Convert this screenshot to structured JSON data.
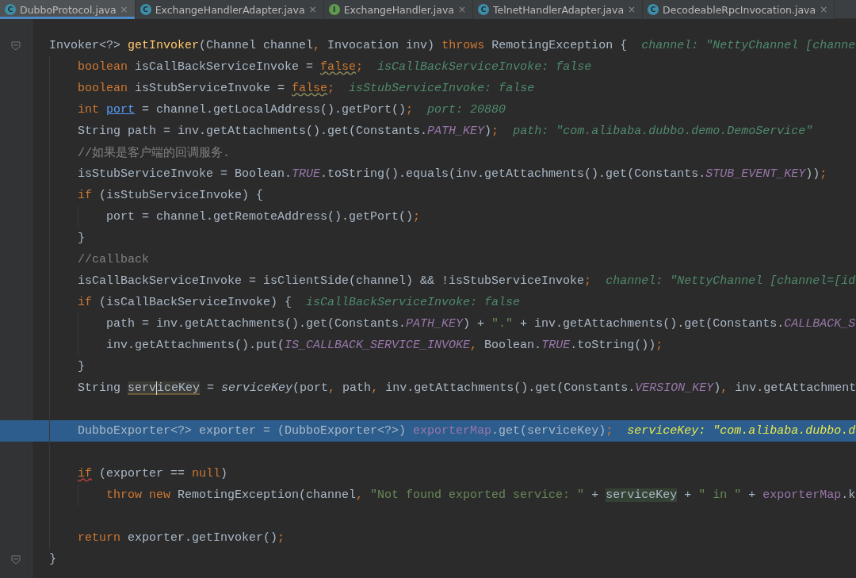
{
  "tabs": [
    {
      "label": "DubboProtocol.java",
      "icon": "C",
      "kind": "class",
      "close": "×",
      "selected": true
    },
    {
      "label": "ExchangeHandlerAdapter.java",
      "icon": "C",
      "kind": "abstract",
      "close": "×",
      "selected": false
    },
    {
      "label": "ExchangeHandler.java",
      "icon": "I",
      "kind": "interface",
      "close": "×",
      "selected": false
    },
    {
      "label": "TelnetHandlerAdapter.java",
      "icon": "C",
      "kind": "class",
      "close": "×",
      "selected": false
    },
    {
      "label": "DecodeableRpcInvocation.java",
      "icon": "C",
      "kind": "class",
      "close": "×",
      "selected": false
    }
  ],
  "lines": [
    {
      "fold": true,
      "selected": false,
      "tokens": [
        {
          "t": "Invoker<?> ",
          "kind": "plain"
        },
        {
          "t": "getInvoker",
          "kind": "fn"
        },
        {
          "t": "(Channel channel",
          "kind": "plain"
        },
        {
          "t": ", ",
          "kind": "kw"
        },
        {
          "t": "Invocation inv) ",
          "kind": "plain"
        },
        {
          "t": "throws ",
          "kind": "kw"
        },
        {
          "t": "RemotingException {",
          "kind": "plain"
        }
      ],
      "hint": "channel: \"NettyChannel [channe",
      "children": [
        {
          "fold": false,
          "selected": false,
          "tokens": [
            {
              "t": "boolean ",
              "kind": "kw"
            },
            {
              "t": "isCallBackServiceInvoke = ",
              "kind": "plain"
            },
            {
              "t": "false",
              "kind": "warn"
            },
            {
              "t": ";",
              "kind": "kw"
            }
          ],
          "hint": "isCallBackServiceInvoke: false"
        },
        {
          "fold": false,
          "selected": false,
          "tokens": [
            {
              "t": "boolean ",
              "kind": "kw"
            },
            {
              "t": "isStubServiceInvoke = ",
              "kind": "plain"
            },
            {
              "t": "false",
              "kind": "warn"
            },
            {
              "t": ";",
              "kind": "kw"
            }
          ],
          "hint": "isStubServiceInvoke: false"
        },
        {
          "fold": false,
          "selected": false,
          "tokens": [
            {
              "t": "int ",
              "kind": "kw"
            },
            {
              "t": "port",
              "kind": "link"
            },
            {
              "t": " = channel.getLocalAddress().getPort()",
              "kind": "plain"
            },
            {
              "t": ";",
              "kind": "kw"
            }
          ],
          "hint": "port: 20880"
        },
        {
          "fold": false,
          "selected": false,
          "tokens": [
            {
              "t": "String path = inv.getAttachments().get(Constants.",
              "kind": "plain"
            },
            {
              "t": "PATH_KEY",
              "kind": "const"
            },
            {
              "t": ")",
              "kind": "plain"
            },
            {
              "t": ";",
              "kind": "kw"
            }
          ],
          "hint": "path: \"com.alibaba.dubbo.demo.DemoService\""
        },
        {
          "fold": false,
          "selected": false,
          "tokens": [
            {
              "t": "//如果是客户端的回调服务.",
              "kind": "comment"
            }
          ]
        },
        {
          "fold": false,
          "selected": false,
          "tokens": [
            {
              "t": "isStubServiceInvoke = Boolean.",
              "kind": "plain"
            },
            {
              "t": "TRUE",
              "kind": "const"
            },
            {
              "t": ".toString().equals(inv.getAttachments().get(Constants.",
              "kind": "plain"
            },
            {
              "t": "STUB_EVENT_KEY",
              "kind": "const"
            },
            {
              "t": "))",
              "kind": "plain"
            },
            {
              "t": ";",
              "kind": "kw"
            }
          ]
        },
        {
          "fold": false,
          "selected": false,
          "tokens": [
            {
              "t": "if ",
              "kind": "kw"
            },
            {
              "t": "(isStubServiceInvoke) {",
              "kind": "plain"
            }
          ],
          "children": [
            {
              "fold": false,
              "selected": false,
              "tokens": [
                {
                  "t": "port = channel.getRemoteAddress().getPort()",
                  "kind": "plain"
                },
                {
                  "t": ";",
                  "kind": "kw"
                }
              ]
            }
          ]
        },
        {
          "fold": false,
          "selected": false,
          "tokens": [
            {
              "t": "}",
              "kind": "plain"
            }
          ]
        },
        {
          "fold": false,
          "selected": false,
          "tokens": [
            {
              "t": "//callback",
              "kind": "comment"
            }
          ]
        },
        {
          "fold": false,
          "selected": false,
          "tokens": [
            {
              "t": "isCallBackServiceInvoke = isClientSide(channel) && !isStubServiceInvoke",
              "kind": "plain"
            },
            {
              "t": ";",
              "kind": "kw"
            }
          ],
          "hint": "channel: \"NettyChannel [channel=[id"
        },
        {
          "fold": false,
          "selected": false,
          "tokens": [
            {
              "t": "if ",
              "kind": "kw"
            },
            {
              "t": "(isCallBackServiceInvoke) {",
              "kind": "plain"
            }
          ],
          "hint": "isCallBackServiceInvoke: false",
          "children": [
            {
              "fold": false,
              "selected": false,
              "tokens": [
                {
                  "t": "path = inv.getAttachments().get(Constants.",
                  "kind": "plain"
                },
                {
                  "t": "PATH_KEY",
                  "kind": "const"
                },
                {
                  "t": ") + ",
                  "kind": "plain"
                },
                {
                  "t": "\".\"",
                  "kind": "str"
                },
                {
                  "t": " + inv.getAttachments().get(Constants.",
                  "kind": "plain"
                },
                {
                  "t": "CALLBACK_S",
                  "kind": "const"
                }
              ]
            },
            {
              "fold": false,
              "selected": false,
              "tokens": [
                {
                  "t": "inv.getAttachments().put(",
                  "kind": "plain"
                },
                {
                  "t": "IS_CALLBACK_SERVICE_INVOKE",
                  "kind": "const"
                },
                {
                  "t": ", ",
                  "kind": "kw"
                },
                {
                  "t": "Boolean.",
                  "kind": "plain"
                },
                {
                  "t": "TRUE",
                  "kind": "const"
                },
                {
                  "t": ".toString())",
                  "kind": "plain"
                },
                {
                  "t": ";",
                  "kind": "kw"
                }
              ]
            }
          ]
        },
        {
          "fold": false,
          "selected": false,
          "tokens": [
            {
              "t": "}",
              "kind": "plain"
            }
          ]
        },
        {
          "fold": false,
          "selected": false,
          "tokens": [
            {
              "t": "String ",
              "kind": "plain"
            },
            {
              "t": "serv",
              "kind": "usage"
            },
            {
              "t": "iceKey",
              "kind": "usage",
              "caret": true
            },
            {
              "t": " = ",
              "kind": "plain"
            },
            {
              "t": "serviceKey",
              "kind": "static"
            },
            {
              "t": "(port",
              "kind": "plain"
            },
            {
              "t": ", ",
              "kind": "kw"
            },
            {
              "t": "path",
              "kind": "plain"
            },
            {
              "t": ", ",
              "kind": "kw"
            },
            {
              "t": "inv.getAttachments().get(Constants.",
              "kind": "plain"
            },
            {
              "t": "VERSION_KEY",
              "kind": "const"
            },
            {
              "t": ")",
              "kind": "plain"
            },
            {
              "t": ", ",
              "kind": "kw"
            },
            {
              "t": "inv.getAttachment",
              "kind": "plain"
            }
          ]
        },
        {
          "kind": "blank"
        },
        {
          "fold": false,
          "selected": true,
          "tokens": [
            {
              "t": "DubboExporter<?> exporter = (DubboExporter<?>) ",
              "kind": "plain"
            },
            {
              "t": "exporterMap",
              "kind": "field"
            },
            {
              "t": ".get(serviceKey)",
              "kind": "plain"
            },
            {
              "t": ";",
              "kind": "kw"
            }
          ],
          "hint": "serviceKey: \"com.alibaba.dubbo.d"
        },
        {
          "kind": "blank"
        },
        {
          "fold": false,
          "selected": false,
          "tokens": [
            {
              "t": "if",
              "kind": "kwwarn"
            },
            {
              "t": " (exporter == ",
              "kind": "plain"
            },
            {
              "t": "null",
              "kind": "kw"
            },
            {
              "t": ")",
              "kind": "plain"
            }
          ],
          "children": [
            {
              "fold": false,
              "selected": false,
              "tokens": [
                {
                  "t": "throw new ",
                  "kind": "kw"
                },
                {
                  "t": "RemotingException(channel",
                  "kind": "plain"
                },
                {
                  "t": ", ",
                  "kind": "kw"
                },
                {
                  "t": "\"Not found exported service: \"",
                  "kind": "str"
                },
                {
                  "t": " + ",
                  "kind": "plain"
                },
                {
                  "t": "serviceKey",
                  "kind": "match"
                },
                {
                  "t": " + ",
                  "kind": "plain"
                },
                {
                  "t": "\" in \"",
                  "kind": "str"
                },
                {
                  "t": " + ",
                  "kind": "plain"
                },
                {
                  "t": "exporterMap",
                  "kind": "field"
                },
                {
                  "t": ".k",
                  "kind": "plain"
                }
              ]
            }
          ]
        },
        {
          "kind": "blank"
        },
        {
          "fold": false,
          "selected": false,
          "tokens": [
            {
              "t": "return ",
              "kind": "kw"
            },
            {
              "t": "exporter.getInvoker()",
              "kind": "plain"
            },
            {
              "t": ";",
              "kind": "kw"
            }
          ]
        }
      ]
    },
    {
      "fold": true,
      "selected": false,
      "tokens": [
        {
          "t": "}",
          "kind": "plain"
        }
      ]
    }
  ]
}
